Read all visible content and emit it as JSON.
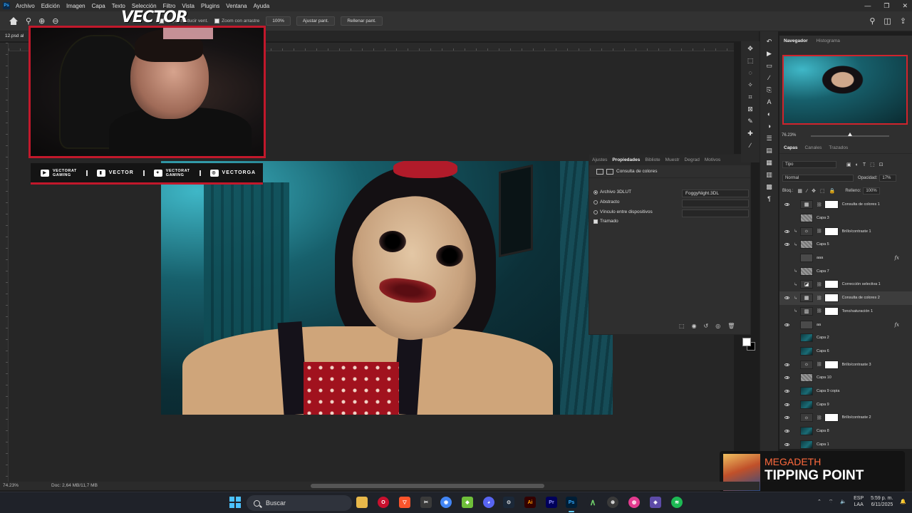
{
  "menubar": {
    "app_logo": "Ps",
    "items": [
      "Archivo",
      "Edición",
      "Imagen",
      "Capa",
      "Texto",
      "Selección",
      "Filtro",
      "Vista",
      "Plugins",
      "Ventana",
      "Ayuda"
    ]
  },
  "options": {
    "resize_windows_label": "Ampliar/reducir vent.",
    "scrubby_zoom_label": "Zoom con arrastre",
    "zoom_100_label": "100%",
    "fit_screen_label": "Ajustar pant.",
    "fill_screen_label": "Rellenar pant."
  },
  "document": {
    "tab_title": "12.psd al"
  },
  "overlay": {
    "brand": "VECTOR",
    "social": [
      {
        "icon": "youtube-icon",
        "line1": "VECTORAT",
        "line2": "GAMING"
      },
      {
        "icon": "twitch-icon",
        "line1": "VECTOR",
        "line2": ""
      },
      {
        "icon": "twitter-icon",
        "line1": "VECTORAT",
        "line2": "GAMING"
      },
      {
        "icon": "instagram-icon",
        "line1": "VECTORGA",
        "line2": ""
      }
    ]
  },
  "properties": {
    "tabs": [
      "Ajustes",
      "Propiedades",
      "Bibliote",
      "Muestr",
      "Degrad",
      "Motivos"
    ],
    "header": "Consulta de colores",
    "options": {
      "file_3dlut": "Archivo 3DLUT",
      "abstract": "Abstracto",
      "device_link": "Vínculo entre dispositivos",
      "dither": "Tramado"
    },
    "lut_value": "FoggyNight.3DL"
  },
  "navigator": {
    "tabs": [
      "Navegador",
      "Histograma"
    ],
    "zoom": "76.23%"
  },
  "layers": {
    "tabs": [
      "Capas",
      "Canales",
      "Trazados"
    ],
    "filter_kind": "Tipo",
    "blend_mode": "Normal",
    "opacity_label": "Opacidad:",
    "opacity_value": "17%",
    "lock_label": "Bloq.:",
    "fill_label": "Relleno:",
    "fill_value": "100%",
    "rows": [
      {
        "name": "Consulta de colores 1",
        "visible": true,
        "clip": false,
        "kind": "adj",
        "glyph": "▦",
        "mask": true
      },
      {
        "name": "Capa 3",
        "visible": false,
        "clip": false,
        "kind": "noise",
        "glyph": "",
        "mask": false
      },
      {
        "name": "Brillo/contraste 1",
        "visible": true,
        "clip": true,
        "kind": "adj",
        "glyph": "☼",
        "mask": true
      },
      {
        "name": "Capa 5",
        "visible": true,
        "clip": true,
        "kind": "noise",
        "glyph": "",
        "mask": false
      },
      {
        "name": "aaa",
        "visible": false,
        "clip": false,
        "kind": "grp",
        "glyph": "",
        "mask": false,
        "fx": true
      },
      {
        "name": "Capa 7",
        "visible": false,
        "clip": true,
        "kind": "noise",
        "glyph": "",
        "mask": false
      },
      {
        "name": "Corrección selectiva 1",
        "visible": false,
        "clip": true,
        "kind": "adj",
        "glyph": "◪",
        "mask": true
      },
      {
        "name": "Consulta de colores 2",
        "visible": true,
        "clip": true,
        "kind": "adj",
        "glyph": "▦",
        "mask": true,
        "selected": true
      },
      {
        "name": "Tono/saturación 1",
        "visible": false,
        "clip": true,
        "kind": "adj",
        "glyph": "▥",
        "mask": true
      },
      {
        "name": "aa",
        "visible": true,
        "clip": false,
        "kind": "grp",
        "glyph": "",
        "mask": false,
        "fx": true
      },
      {
        "name": "Capa 2",
        "visible": false,
        "clip": false,
        "kind": "img",
        "glyph": "",
        "mask": false
      },
      {
        "name": "Capa 6",
        "visible": false,
        "clip": false,
        "kind": "img",
        "glyph": "",
        "mask": false
      },
      {
        "name": "Brillo/contraste 3",
        "visible": true,
        "clip": false,
        "kind": "adj",
        "glyph": "☼",
        "mask": true
      },
      {
        "name": "Capa 10",
        "visible": true,
        "clip": false,
        "kind": "noise",
        "glyph": "",
        "mask": false
      },
      {
        "name": "Capa 9 copia",
        "visible": true,
        "clip": false,
        "kind": "img",
        "glyph": "",
        "mask": false
      },
      {
        "name": "Capa 9",
        "visible": true,
        "clip": false,
        "kind": "img",
        "glyph": "",
        "mask": false
      },
      {
        "name": "Brillo/contraste 2",
        "visible": true,
        "clip": false,
        "kind": "adj",
        "glyph": "☼",
        "mask": true
      },
      {
        "name": "Capa 8",
        "visible": true,
        "clip": false,
        "kind": "img",
        "glyph": "",
        "mask": false
      },
      {
        "name": "Capa 1",
        "visible": true,
        "clip": false,
        "kind": "img",
        "glyph": "",
        "mask": false
      }
    ]
  },
  "now_playing": {
    "artist": "MEGADETH",
    "track": "TIPPING POINT"
  },
  "status": {
    "zoom": "74.23%",
    "doc_info": "Doc: 2,64 MB/11,7 MB"
  },
  "taskbar": {
    "search_placeholder": "Buscar",
    "lang_line1": "ESP",
    "lang_line2": "LAA",
    "time": "5:59 p. m.",
    "date": "6/11/2025"
  },
  "colors": {
    "accent_red": "#c2182b",
    "ui_panel": "#2f2f2f",
    "ui_background": "#1d1d1d",
    "artist_orange": "#ff6a3d"
  }
}
